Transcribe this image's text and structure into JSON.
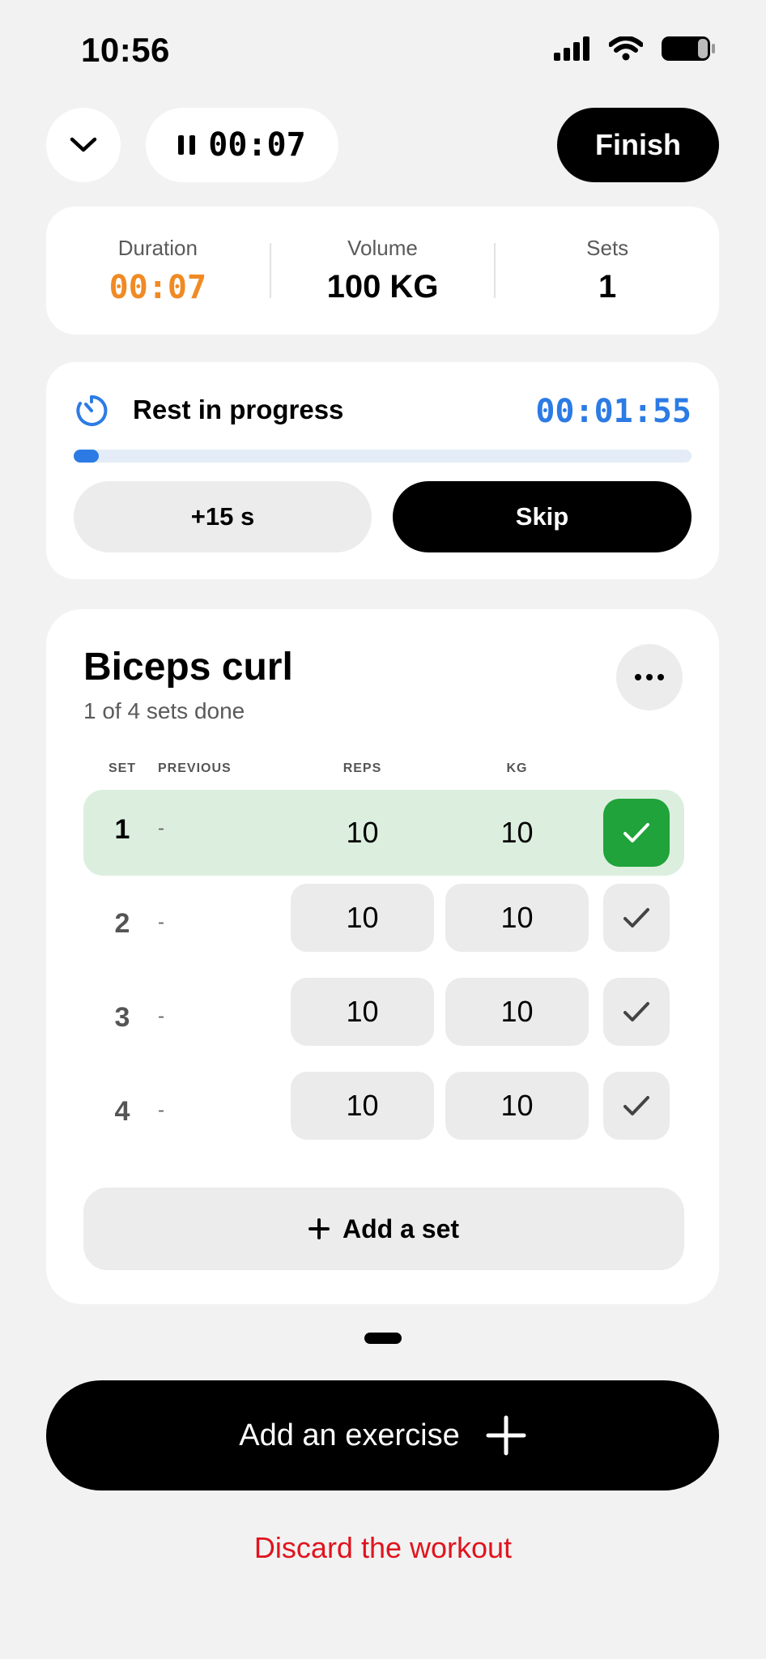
{
  "status_bar": {
    "time": "10:56",
    "signal": "signal-icon",
    "wifi": "wifi-icon",
    "battery": "battery-icon"
  },
  "top_bar": {
    "collapse_icon": "chevron-down-icon",
    "elapsed_timer": "00:07",
    "pause_icon": "pause-icon",
    "finish_label": "Finish"
  },
  "stats": {
    "duration_label": "Duration",
    "duration_value": "00:07",
    "volume_label": "Volume",
    "volume_value": "100 KG",
    "sets_label": "Sets",
    "sets_value": "1"
  },
  "rest": {
    "icon": "timer-icon",
    "title": "Rest in progress",
    "remaining": "00:01:55",
    "progress_fraction": 0.04,
    "add_time_label": "+15 s",
    "skip_label": "Skip"
  },
  "exercise": {
    "name": "Biceps curl",
    "progress_text": "1 of 4 sets done",
    "more_icon": "more-icon",
    "columns": {
      "set": "SET",
      "previous": "PREVIOUS",
      "reps": "REPS",
      "kg": "KG"
    },
    "sets": [
      {
        "set": "1",
        "previous": "-",
        "reps": "10",
        "kg": "10",
        "done": true
      },
      {
        "set": "2",
        "previous": "-",
        "reps": "10",
        "kg": "10",
        "done": false
      },
      {
        "set": "3",
        "previous": "-",
        "reps": "10",
        "kg": "10",
        "done": false
      },
      {
        "set": "4",
        "previous": "-",
        "reps": "10",
        "kg": "10",
        "done": false
      }
    ],
    "add_set_label": "Add a set"
  },
  "bottom": {
    "add_exercise_label": "Add an exercise",
    "discard_label": "Discard the workout"
  },
  "colors": {
    "accent_blue": "#2c7be5",
    "duration_orange": "#f08a24",
    "done_green": "#1fa33a",
    "done_row_bg": "#dcefdf",
    "discard_red": "#e0141e"
  }
}
